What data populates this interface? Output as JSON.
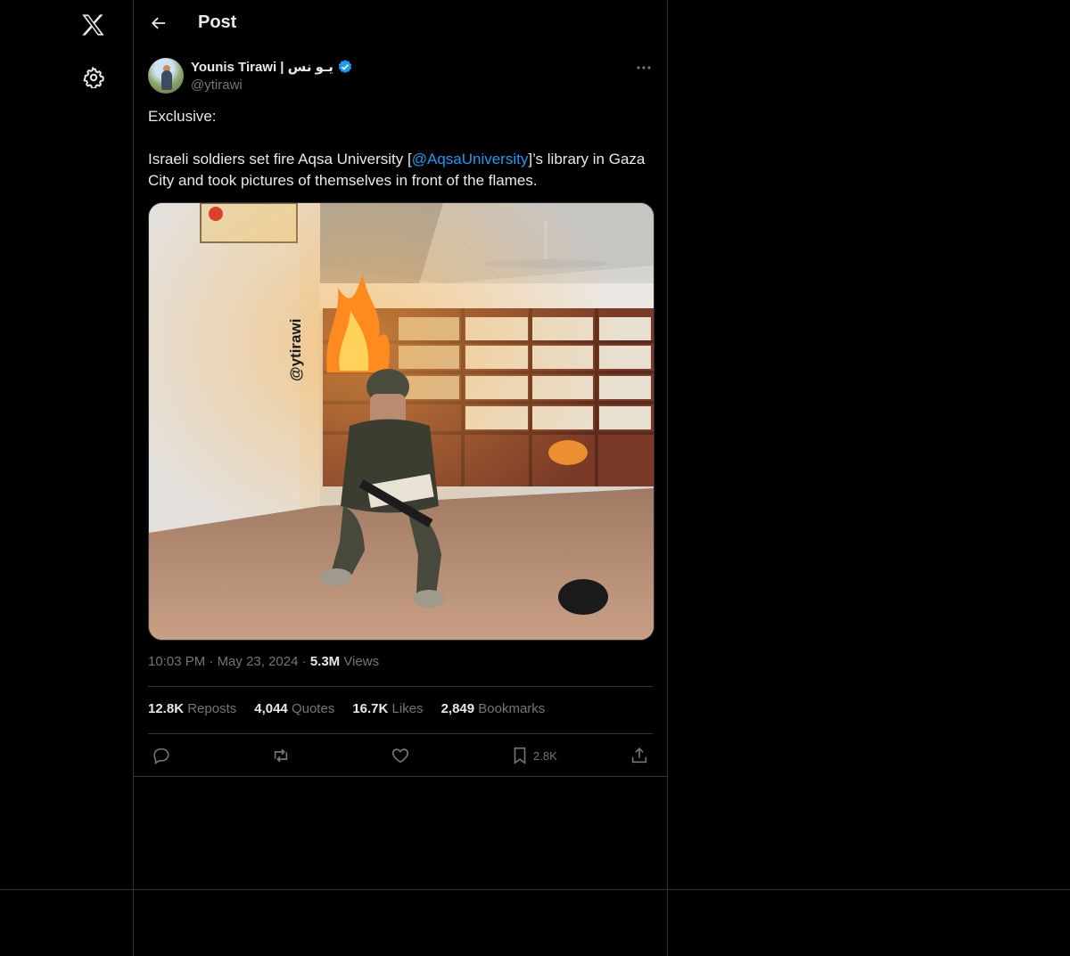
{
  "nav": {
    "logo_icon": "x-logo-icon",
    "settings_icon": "gear-icon"
  },
  "header": {
    "title": "Post"
  },
  "author": {
    "name": "Younis Tirawi | يـو نس",
    "handle": "@ytirawi",
    "verified": true
  },
  "tweet": {
    "line1": "Exclusive:",
    "line2_before": "Israeli soldiers set fire Aqsa University [",
    "mention": "@AqsaUniversity",
    "line2_after": "]’s library in Gaza City and took pictures of themselves in front of the flames.",
    "watermark": "@ytirawi"
  },
  "meta": {
    "time": "10:03 PM",
    "date": "May 23, 2024",
    "views_count": "5.3M",
    "views_label": "Views",
    "sep": "·"
  },
  "stats": [
    {
      "count": "12.8K",
      "label": "Reposts"
    },
    {
      "count": "4,044",
      "label": "Quotes"
    },
    {
      "count": "16.7K",
      "label": "Likes"
    },
    {
      "count": "2,849",
      "label": "Bookmarks"
    }
  ],
  "actions": {
    "bookmark_count": "2.8K"
  },
  "colors": {
    "accent": "#1d9bf0",
    "border": "#2f3336",
    "muted": "#71767b",
    "text": "#e7e9ea"
  }
}
